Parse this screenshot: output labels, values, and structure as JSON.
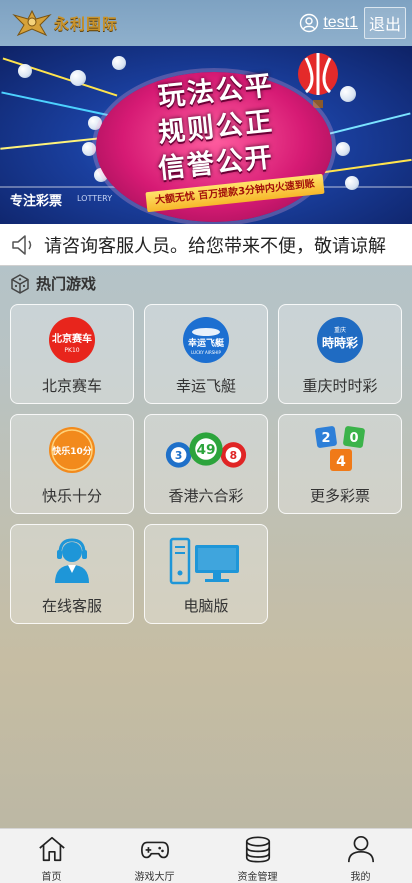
{
  "header": {
    "logo_text": "永利国际",
    "username": "test1",
    "logout_label": "退出"
  },
  "banner": {
    "title_lines": [
      "玩法公平",
      "规则公正",
      "信誉公开"
    ],
    "strip_text": "大额无忧 百万提款3分钟内火速到账",
    "left_text": "专注彩票",
    "left_sub": "LOTTERY"
  },
  "marquee": {
    "text": "请咨询客服人员。给您带来不便，敬请谅解"
  },
  "section": {
    "title": "热门游戏"
  },
  "games": [
    {
      "label": "北京赛车",
      "icon": "beijing-racing-icon",
      "badge": "北京赛车",
      "badge_sub": "PK10",
      "color": "#e8251c"
    },
    {
      "label": "幸运飞艇",
      "icon": "lucky-airship-icon",
      "badge": "幸运飞艇",
      "badge_sub": "LUCKY AIRSHIP",
      "color": "#1c6fd1"
    },
    {
      "label": "重庆时时彩",
      "icon": "chongqing-ssc-icon",
      "badge": "時時彩",
      "badge_sub": "重庆",
      "color": "#1f6bc2"
    },
    {
      "label": "快乐十分",
      "icon": "happy-ten-icon",
      "badge": "快乐10分",
      "color": "#f28a1c"
    },
    {
      "label": "香港六合彩",
      "icon": "hk-mark-six-icon",
      "balls": [
        "3",
        "49",
        "8"
      ]
    },
    {
      "label": "更多彩票",
      "icon": "more-lottery-icon",
      "dice": [
        "2",
        "0",
        "4"
      ]
    },
    {
      "label": "在线客服",
      "icon": "customer-service-icon"
    },
    {
      "label": "电脑版",
      "icon": "desktop-icon"
    }
  ],
  "bottom_nav": [
    {
      "label": "首页",
      "icon": "home-icon"
    },
    {
      "label": "游戏大厅",
      "icon": "gamepad-icon"
    },
    {
      "label": "资金管理",
      "icon": "coins-icon"
    },
    {
      "label": "我的",
      "icon": "user-icon"
    }
  ]
}
